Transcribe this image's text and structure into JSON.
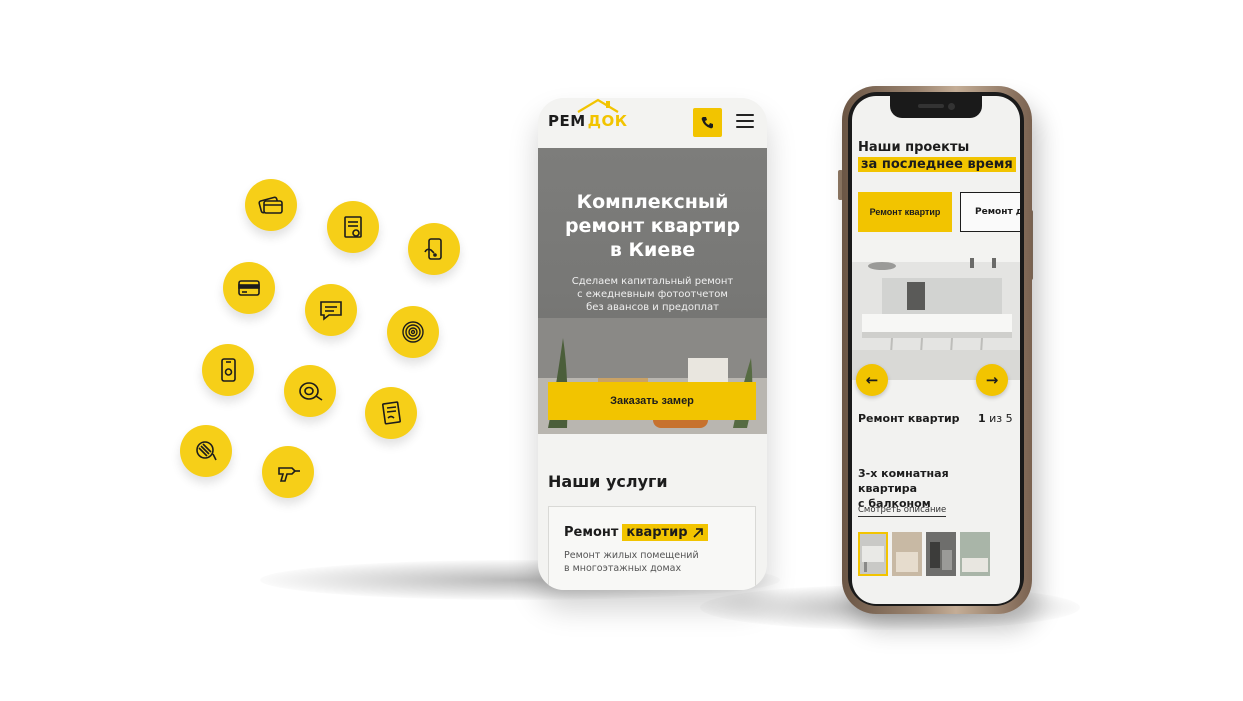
{
  "colors": {
    "accent": "#f2c400",
    "text": "#1c1c1c",
    "bg": "#ffffff"
  },
  "floating_icons": [
    {
      "name": "cards-icon"
    },
    {
      "name": "document-stamp-icon"
    },
    {
      "name": "phone-hand-icon"
    },
    {
      "name": "credit-card-icon"
    },
    {
      "name": "chat-message-icon"
    },
    {
      "name": "target-spiral-icon"
    },
    {
      "name": "smartphone-icon"
    },
    {
      "name": "tape-measure-icon"
    },
    {
      "name": "contract-icon"
    },
    {
      "name": "roller-icon"
    },
    {
      "name": "drill-icon"
    }
  ],
  "left_screen": {
    "logo_prefix": "РЕМ",
    "logo_suffix": "ДОК",
    "hero_title_line1": "Комплексный",
    "hero_title_line2": "ремонт квартир",
    "hero_title_line3": "в Киеве",
    "hero_sub_line1": "Сделаем капитальный ремонт",
    "hero_sub_line2": "с ежедневным фотоотчетом",
    "hero_sub_line3": "без авансов и предоплат",
    "cta_label": "Заказать замер",
    "services_title": "Наши услуги",
    "service_card": {
      "title_plain": "Ремонт",
      "title_highlight": "квартир",
      "desc_line1": "Ремонт жилых помещений",
      "desc_line2": "в многоэтажных домах"
    }
  },
  "right_screen": {
    "title_line1": "Наши проекты",
    "title_line2": "за последнее время",
    "tab_active": "Ремонт квартир",
    "tab_inactive": "Ремонт д",
    "caption_left": "Ремонт  квартир",
    "caption_current": "1",
    "caption_rest": " из 5",
    "apartment_title_line1": "3-х комнатная квартира",
    "apartment_title_line2": "с балконом",
    "details_link": "Смотреть описание",
    "prev_arrow": "←",
    "next_arrow": "→"
  }
}
